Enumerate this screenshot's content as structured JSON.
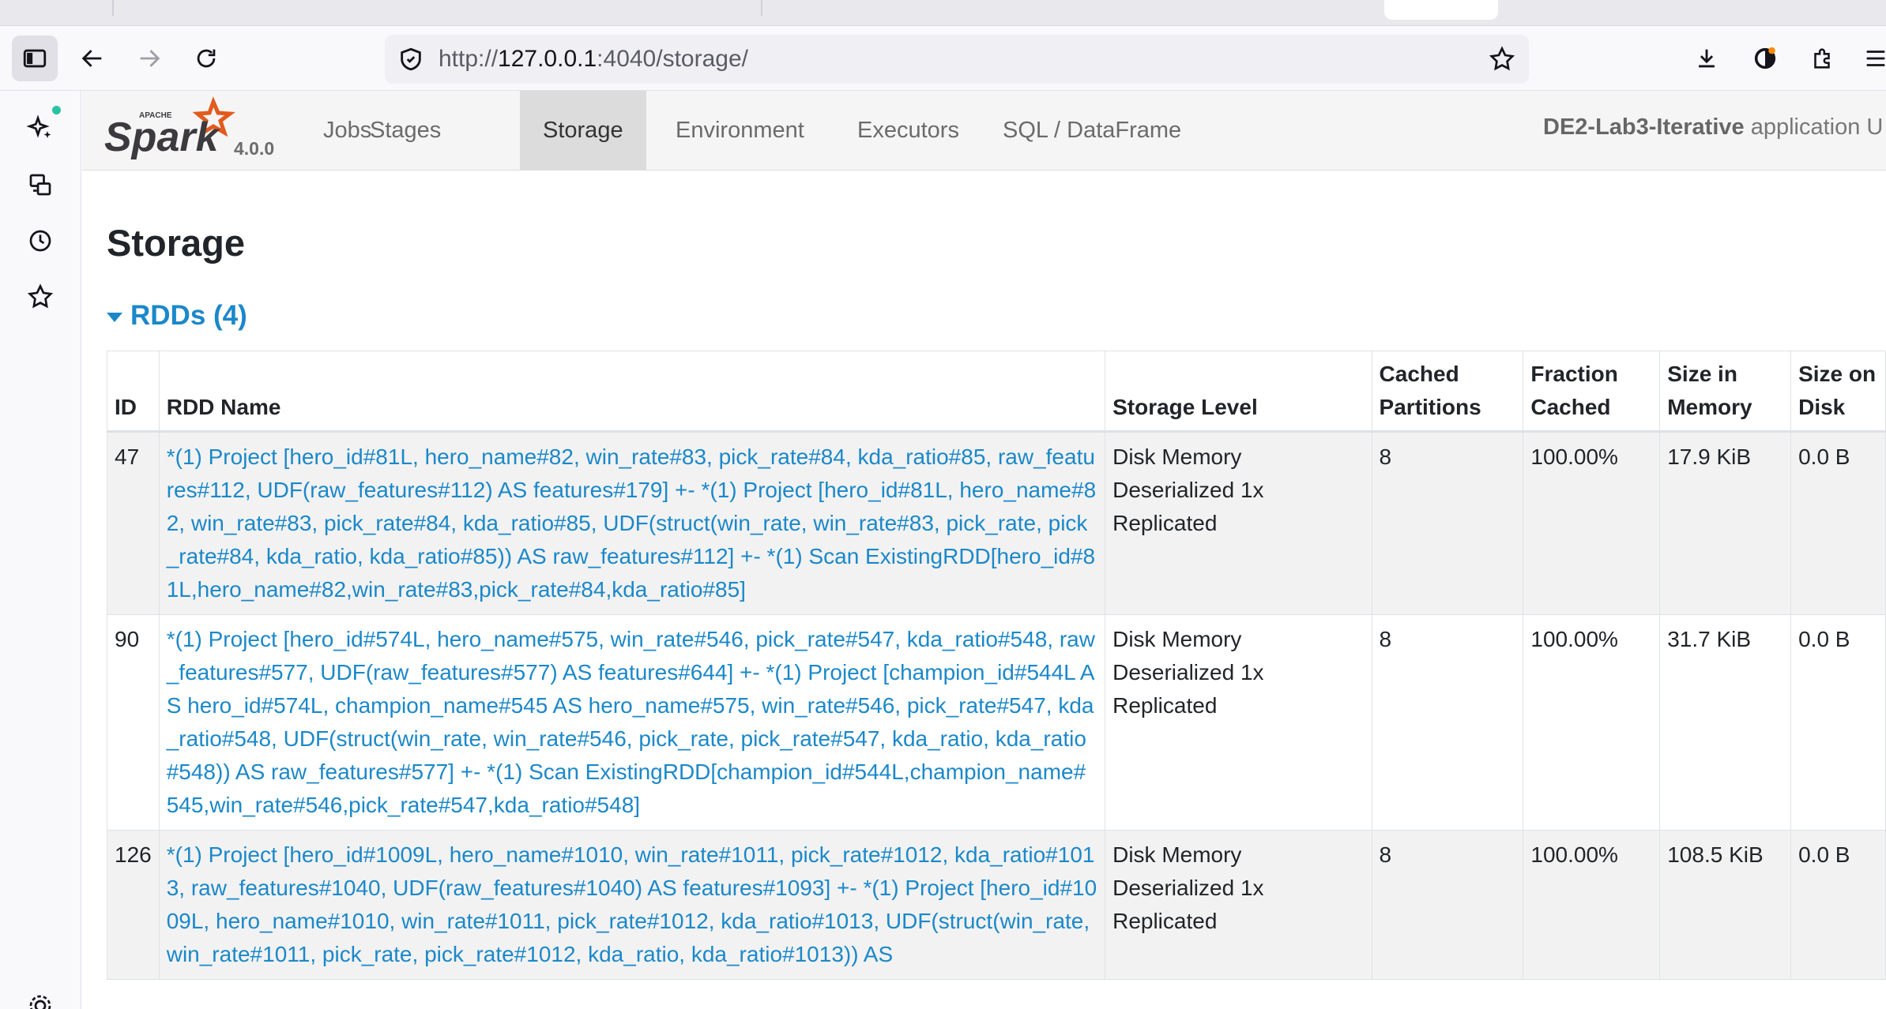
{
  "browser": {
    "url_prefix": "http://",
    "url_host": "127.0.0.1",
    "url_path": ":4040/storage/"
  },
  "spark": {
    "logo_small": "APACHE",
    "logo_text": "Spark",
    "version": "4.0.0",
    "tabs": [
      {
        "label": "Jobs",
        "active": false
      },
      {
        "label": "Stages",
        "active": false
      },
      {
        "label": "Storage",
        "active": true
      },
      {
        "label": "Environment",
        "active": false
      },
      {
        "label": "Executors",
        "active": false
      },
      {
        "label": "SQL / DataFrame",
        "active": false
      }
    ],
    "app_name": "DE2-Lab3-Iterative",
    "app_suffix": "application U"
  },
  "page": {
    "title": "Storage",
    "rdd_section_label": "RDDs (4)"
  },
  "table": {
    "headers": [
      "ID",
      "RDD Name",
      "Storage Level",
      "Cached Partitions",
      "Fraction Cached",
      "Size in Memory",
      "Size on Disk"
    ],
    "rows": [
      {
        "id": "47",
        "name": "*(1) Project [hero_id#81L, hero_name#82, win_rate#83, pick_rate#84, kda_ratio#85, raw_features#112, UDF(raw_features#112) AS features#179] +- *(1) Project [hero_id#81L, hero_name#82, win_rate#83, pick_rate#84, kda_ratio#85, UDF(struct(win_rate, win_rate#83, pick_rate, pick_rate#84, kda_ratio, kda_ratio#85)) AS raw_features#112] +- *(1) Scan ExistingRDD[hero_id#81L,hero_name#82,win_rate#83,pick_rate#84,kda_ratio#85]",
        "storage_level": "Disk Memory Deserialized 1x Replicated",
        "cached_partitions": "8",
        "fraction_cached": "100.00%",
        "size_in_memory": "17.9 KiB",
        "size_on_disk": "0.0 B"
      },
      {
        "id": "90",
        "name": "*(1) Project [hero_id#574L, hero_name#575, win_rate#546, pick_rate#547, kda_ratio#548, raw_features#577, UDF(raw_features#577) AS features#644] +- *(1) Project [champion_id#544L AS hero_id#574L, champion_name#545 AS hero_name#575, win_rate#546, pick_rate#547, kda_ratio#548, UDF(struct(win_rate, win_rate#546, pick_rate, pick_rate#547, kda_ratio, kda_ratio#548)) AS raw_features#577] +- *(1) Scan ExistingRDD[champion_id#544L,champion_name#545,win_rate#546,pick_rate#547,kda_ratio#548]",
        "storage_level": "Disk Memory Deserialized 1x Replicated",
        "cached_partitions": "8",
        "fraction_cached": "100.00%",
        "size_in_memory": "31.7 KiB",
        "size_on_disk": "0.0 B"
      },
      {
        "id": "126",
        "name": "*(1) Project [hero_id#1009L, hero_name#1010, win_rate#1011, pick_rate#1012, kda_ratio#1013, raw_features#1040, UDF(raw_features#1040) AS features#1093] +- *(1) Project [hero_id#1009L, hero_name#1010, win_rate#1011, pick_rate#1012, kda_ratio#1013, UDF(struct(win_rate, win_rate#1011, pick_rate, pick_rate#1012, kda_ratio, kda_ratio#1013)) AS",
        "storage_level": "Disk Memory Deserialized 1x Replicated",
        "cached_partitions": "8",
        "fraction_cached": "100.00%",
        "size_in_memory": "108.5 KiB",
        "size_on_disk": "0.0 B"
      }
    ]
  }
}
